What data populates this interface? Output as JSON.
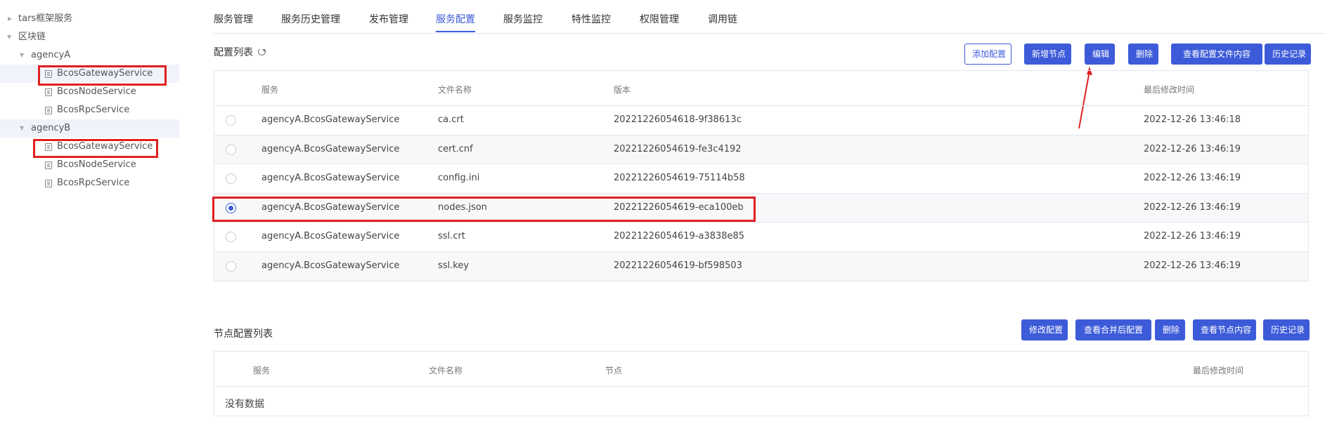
{
  "sidebar": {
    "root": "tars框架服务",
    "blockchain": "区块链",
    "groups": [
      {
        "label": "agencyA",
        "services": [
          "BcosGatewayService",
          "BcosNodeService",
          "BcosRpcService"
        ]
      },
      {
        "label": "agencyB",
        "services": [
          "BcosGatewayService",
          "BcosNodeService",
          "BcosRpcService"
        ]
      }
    ]
  },
  "tabs": [
    "服务管理",
    "服务历史管理",
    "发布管理",
    "服务配置",
    "服务监控",
    "特性监控",
    "权限管理",
    "调用链"
  ],
  "active_tab": "服务配置",
  "config_list": {
    "title": "配置列表",
    "buttons": [
      "添加配置",
      "新增节点",
      "编辑",
      "删除",
      "查看配置文件内容",
      "历史记录"
    ],
    "columns": [
      "服务",
      "文件名称",
      "版本",
      "最后修改时间"
    ],
    "rows": [
      {
        "service": "agencyA.BcosGatewayService",
        "file": "ca.crt",
        "version": "20221226054618-9f38613c",
        "modified": "2022-12-26 13:46:18",
        "selected": false
      },
      {
        "service": "agencyA.BcosGatewayService",
        "file": "cert.cnf",
        "version": "20221226054619-fe3c4192",
        "modified": "2022-12-26 13:46:19",
        "selected": false
      },
      {
        "service": "agencyA.BcosGatewayService",
        "file": "config.ini",
        "version": "20221226054619-75114b58",
        "modified": "2022-12-26 13:46:19",
        "selected": false
      },
      {
        "service": "agencyA.BcosGatewayService",
        "file": "nodes.json",
        "version": "20221226054619-eca100eb",
        "modified": "2022-12-26 13:46:19",
        "selected": true
      },
      {
        "service": "agencyA.BcosGatewayService",
        "file": "ssl.crt",
        "version": "20221226054619-a3838e85",
        "modified": "2022-12-26 13:46:19",
        "selected": false
      },
      {
        "service": "agencyA.BcosGatewayService",
        "file": "ssl.key",
        "version": "20221226054619-bf598503",
        "modified": "2022-12-26 13:46:19",
        "selected": false
      }
    ]
  },
  "node_config_list": {
    "title": "节点配置列表",
    "buttons": [
      "修改配置",
      "查看合并后配置",
      "删除",
      "查看节点内容",
      "历史记录"
    ],
    "columns": [
      "服务",
      "文件名称",
      "节点",
      "最后修改时间"
    ],
    "empty_text": "没有数据"
  },
  "colors": {
    "accent": "#3d5bd9",
    "highlight": "#e02020"
  }
}
